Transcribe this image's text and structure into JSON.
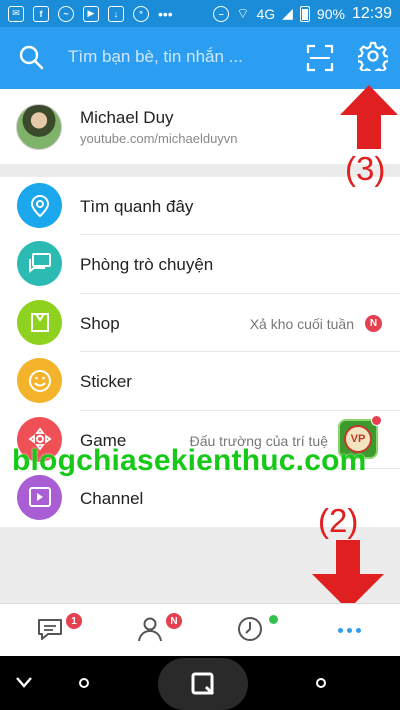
{
  "status_bar": {
    "network": "4G",
    "battery": "90%",
    "time": "12:39"
  },
  "header": {
    "search_placeholder": "Tìm bạn bè, tin nhắn ..."
  },
  "profile": {
    "name": "Michael Duy",
    "subtitle": "youtube.com/michaelduyvn"
  },
  "menu": {
    "items": [
      {
        "label": "Tìm quanh đây",
        "color": "#1aa7ec",
        "icon": "location-pin-icon"
      },
      {
        "label": "Phòng trò chuyện",
        "color": "#2bbbb3",
        "icon": "chat-rooms-icon"
      },
      {
        "label": "Shop",
        "color": "#8fd11f",
        "icon": "shopping-bag-icon",
        "sub": "Xả kho cuối tuần",
        "badge": "N"
      },
      {
        "label": "Sticker",
        "color": "#f3b32a",
        "icon": "smiley-icon"
      },
      {
        "label": "Game",
        "color": "#ef5055",
        "icon": "gamepad-icon",
        "sub": "Đấu trường của trí tuệ"
      },
      {
        "label": "Channel",
        "color": "#a95ed3",
        "icon": "video-channel-icon"
      }
    ]
  },
  "watermark": "blogchiasekienthuc.com",
  "annotations": {
    "settings": "(3)",
    "more": "(2)"
  },
  "tabs": {
    "messages_badge": "1",
    "contacts_badge": "N"
  },
  "colors": {
    "header": "#2c9ef2",
    "status_bar": "#1a8cd8",
    "annotation": "#e02020",
    "watermark": "#16c916"
  }
}
